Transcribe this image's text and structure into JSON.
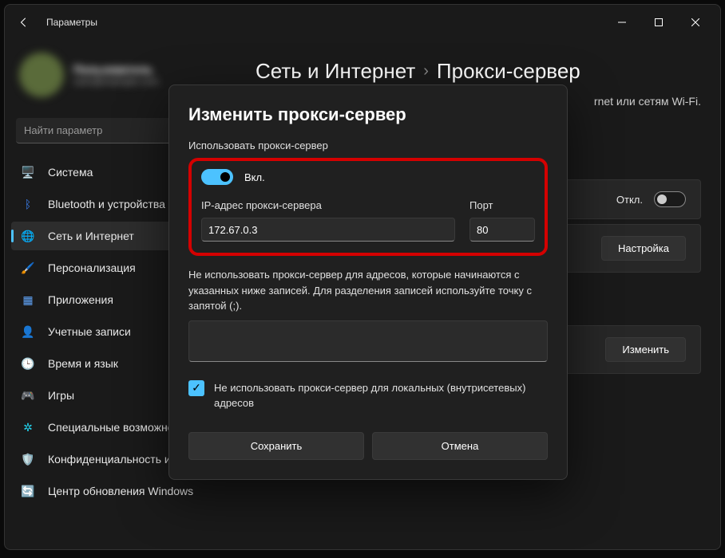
{
  "window": {
    "title": "Параметры"
  },
  "profile": {
    "name": "Пользователь",
    "email": "user@example.com"
  },
  "search": {
    "placeholder": "Найти параметр"
  },
  "sidebar": {
    "items": [
      {
        "icon": "🖥️",
        "label": "Система",
        "color": "#4cc2ff"
      },
      {
        "icon": "ᛒ",
        "label": "Bluetooth и устройства",
        "color": "#3b82f6"
      },
      {
        "icon": "🌐",
        "label": "Сеть и Интернет",
        "color": "#4cc2ff"
      },
      {
        "icon": "🖌️",
        "label": "Персонализация",
        "color": "#e879f9"
      },
      {
        "icon": "▦",
        "label": "Приложения",
        "color": "#60a5fa"
      },
      {
        "icon": "👤",
        "label": "Учетные записи",
        "color": "#a78bfa"
      },
      {
        "icon": "🕒",
        "label": "Время и язык",
        "color": "#38bdf8"
      },
      {
        "icon": "🎮",
        "label": "Игры",
        "color": "#f472b6"
      },
      {
        "icon": "✲",
        "label": "Специальные возможности",
        "color": "#22d3ee"
      },
      {
        "icon": "🛡️",
        "label": "Конфиденциальность и защита",
        "color": "#9ca3af"
      },
      {
        "icon": "🔄",
        "label": "Центр обновления Windows",
        "color": "#38bdf8"
      }
    ],
    "active_index": 2
  },
  "breadcrumb": {
    "a": "Сеть и Интернет",
    "b": "Прокси-сервер"
  },
  "hub": {
    "subtitle_frag": "rnet или сетям Wi-Fi."
  },
  "cards": {
    "off_label": "Откл.",
    "setup_btn": "Настройка",
    "change_btn": "Изменить"
  },
  "dialog": {
    "title": "Изменить прокси-сервер",
    "use_proxy_label": "Использовать прокси-сервер",
    "toggle_state": "Вкл.",
    "ip_label": "IP-адрес прокси-сервера",
    "ip_value": "172.67.0.3",
    "port_label": "Порт",
    "port_value": "80",
    "exceptions_text": "Не использовать прокси-сервер для адресов, которые начинаются с указанных ниже записей. Для разделения записей используйте точку с запятой (;).",
    "exceptions_value": "",
    "local_checkbox_label": "Не использовать прокси-сервер для локальных (внутрисетевых) адресов",
    "save": "Сохранить",
    "cancel": "Отмена"
  }
}
